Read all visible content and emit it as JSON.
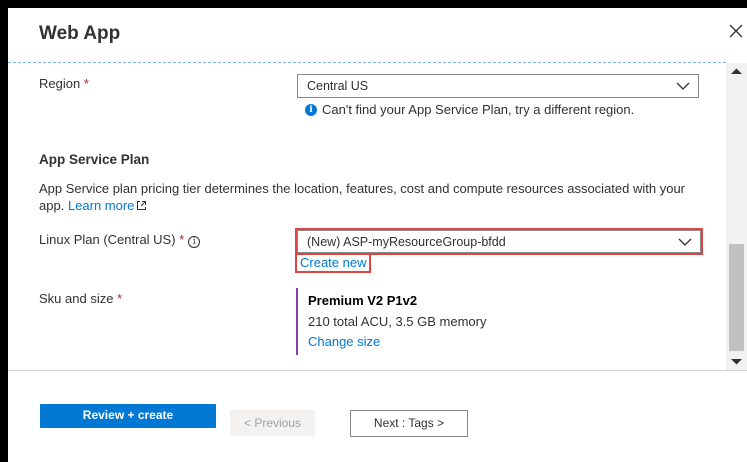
{
  "header": {
    "title": "Web App",
    "close_icon": "close-icon"
  },
  "region": {
    "label": "Region",
    "required_mark": "*",
    "value": "Central US",
    "info_text": "Can't find your App Service Plan, try a different region."
  },
  "app_service_plan": {
    "section_title": "App Service Plan",
    "description": "App Service plan pricing tier determines the location, features, cost and compute resources associated with your app.",
    "learn_more": "Learn more",
    "linux_plan_label": "Linux Plan (Central US)",
    "linux_plan_required": "*",
    "linux_plan_value": "(New) ASP-myResourceGroup-bfdd",
    "create_new": "Create new"
  },
  "sku": {
    "label": "Sku and size",
    "required_mark": "*",
    "name": "Premium V2 P1v2",
    "spec": "210 total ACU, 3.5 GB memory",
    "change_size": "Change size",
    "accent_color": "#8f3db0"
  },
  "footer": {
    "review_create": "Review + create",
    "previous": "< Previous",
    "next": "Next : Tags >"
  },
  "colors": {
    "primary": "#0078d4",
    "highlight": "#e04343",
    "required": "#a4262c"
  }
}
